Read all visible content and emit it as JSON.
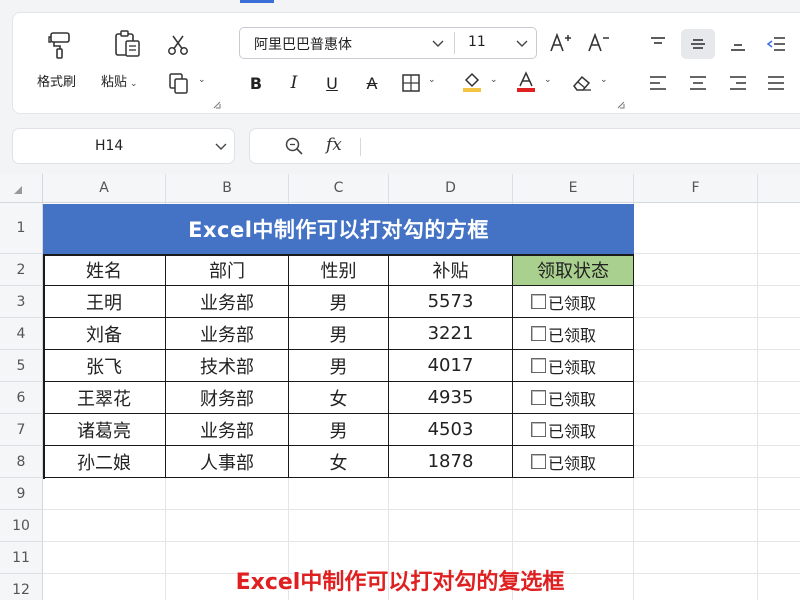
{
  "ribbon": {
    "format_painter_label": "格式刷",
    "paste_label": "粘贴",
    "font_name": "阿里巴巴普惠体",
    "font_size": "11",
    "colors": {
      "highlight": "#f5c542",
      "font_color": "#e02020",
      "accent": "#3b6fd8"
    }
  },
  "formula_bar": {
    "cell_ref": "H14",
    "fx_label": "fx",
    "formula": ""
  },
  "sheet": {
    "columns": [
      "A",
      "B",
      "C",
      "D",
      "E",
      "F"
    ],
    "rows": [
      "1",
      "2",
      "3",
      "4",
      "5",
      "6",
      "7",
      "8",
      "9",
      "10",
      "11",
      "12"
    ],
    "title": "Excel中制作可以打对勾的方框",
    "headers": [
      "姓名",
      "部门",
      "性别",
      "补贴",
      "领取状态"
    ],
    "data": [
      {
        "name": "王明",
        "dept": "业务部",
        "gender": "男",
        "subsidy": "5573",
        "status": "已领取"
      },
      {
        "name": "刘备",
        "dept": "业务部",
        "gender": "男",
        "subsidy": "3221",
        "status": "已领取"
      },
      {
        "name": "张飞",
        "dept": "技术部",
        "gender": "男",
        "subsidy": "4017",
        "status": "已领取"
      },
      {
        "name": "王翠花",
        "dept": "财务部",
        "gender": "女",
        "subsidy": "4935",
        "status": "已领取"
      },
      {
        "name": "诸葛亮",
        "dept": "业务部",
        "gender": "男",
        "subsidy": "4503",
        "status": "已领取"
      },
      {
        "name": "孙二娘",
        "dept": "人事部",
        "gender": "女",
        "subsidy": "1878",
        "status": "已领取"
      }
    ],
    "header_fill": "#4472c4",
    "status_header_fill": "#a9d08e"
  },
  "caption": "Excel中制作可以打对勾的复选框"
}
